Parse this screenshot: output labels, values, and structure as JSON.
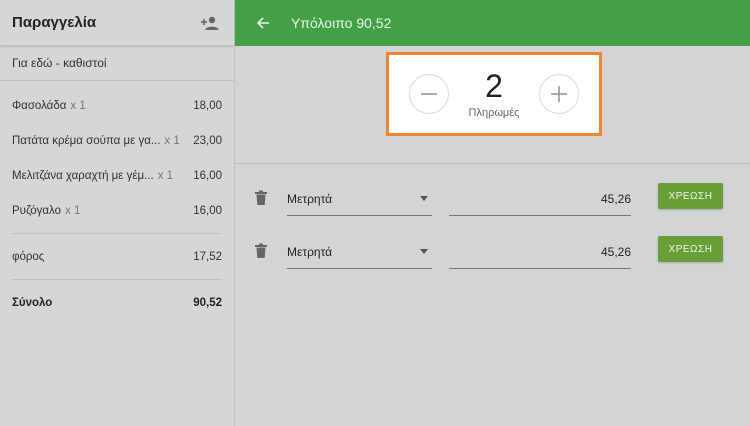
{
  "order": {
    "title": "Παραγγελία",
    "subtitle": "Για εδώ - καθιστοί",
    "items": [
      {
        "name": "Φασολάδα",
        "qty": "x 1",
        "price": "18,00"
      },
      {
        "name": "Πατάτα κρέμα σούπα με γα...",
        "qty": "x 1",
        "price": "23,00"
      },
      {
        "name": "Μελιτζάνα χαραχτή με γέμ...",
        "qty": "x 1",
        "price": "16,00"
      },
      {
        "name": "Ρυζόγαλο",
        "qty": "x 1",
        "price": "16,00"
      }
    ],
    "tax_label": "φόρος",
    "tax_value": "17,52",
    "total_label": "Σύνολο",
    "total_value": "90,52"
  },
  "topbar": {
    "title": "Υπόλοιπο 90,52"
  },
  "payments_counter": {
    "count": "2",
    "label": "Πληρωμές"
  },
  "payments": [
    {
      "method": "Μετρητά",
      "amount": "45,26",
      "button": "ΧΡΕΩΣΗ"
    },
    {
      "method": "Μετρητά",
      "amount": "45,26",
      "button": "ΧΡΕΩΣΗ"
    }
  ],
  "colors": {
    "topbar": "#43a047",
    "charge_button": "#689f38",
    "highlight": "#f08532"
  },
  "icons": {
    "add_person": "person-add-icon",
    "back": "arrow-back-icon",
    "minus": "minus-icon",
    "plus": "plus-icon",
    "trash": "trash-icon",
    "dropdown": "caret-down-icon"
  }
}
